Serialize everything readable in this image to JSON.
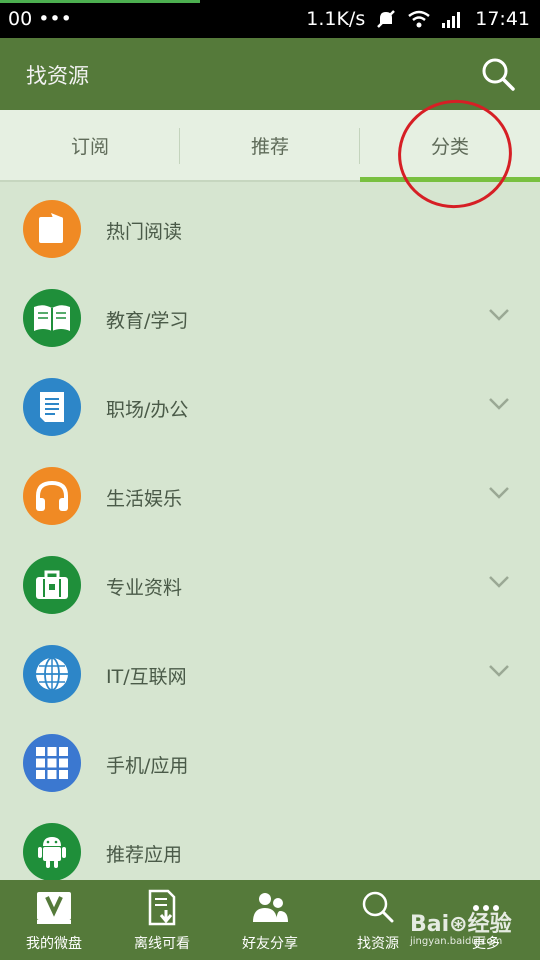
{
  "status": {
    "left": "00 •••",
    "speed": "1.1K/s",
    "time": "17:41"
  },
  "appbar": {
    "title": "找资源",
    "search_icon": "search-icon"
  },
  "tabs": [
    {
      "label": "订阅",
      "active": false
    },
    {
      "label": "推荐",
      "active": false
    },
    {
      "label": "分类",
      "active": true
    }
  ],
  "categories": [
    {
      "label": "热门阅读",
      "icon": "book-card-icon",
      "color": "#f08a24",
      "expandable": false
    },
    {
      "label": "教育/学习",
      "icon": "open-book-icon",
      "color": "#1f8f3a",
      "expandable": true
    },
    {
      "label": "职场/办公",
      "icon": "document-icon",
      "color": "#2d86c8",
      "expandable": true
    },
    {
      "label": "生活娱乐",
      "icon": "headphones-icon",
      "color": "#f08a24",
      "expandable": true
    },
    {
      "label": "专业资料",
      "icon": "briefcase-icon",
      "color": "#1f8f3a",
      "expandable": true
    },
    {
      "label": "IT/互联网",
      "icon": "globe-icon",
      "color": "#2d86c8",
      "expandable": true
    },
    {
      "label": "手机/应用",
      "icon": "grid-icon",
      "color": "#3b78d0",
      "expandable": false
    },
    {
      "label": "推荐应用",
      "icon": "android-icon",
      "color": "#1f8f3a",
      "expandable": false
    }
  ],
  "bottom_nav": [
    {
      "label": "我的微盘",
      "icon": "drive-icon"
    },
    {
      "label": "离线可看",
      "icon": "download-doc-icon"
    },
    {
      "label": "好友分享",
      "icon": "friends-icon"
    },
    {
      "label": "找资源",
      "icon": "search-icon"
    },
    {
      "label": "更多",
      "icon": "more-icon"
    }
  ],
  "watermark": {
    "brand": "Bai⊛经验",
    "url": "jingyan.baidu.com"
  },
  "colors": {
    "appbar": "#557a3a",
    "tab_active": "#79c040",
    "annotation": "#d61f25"
  }
}
